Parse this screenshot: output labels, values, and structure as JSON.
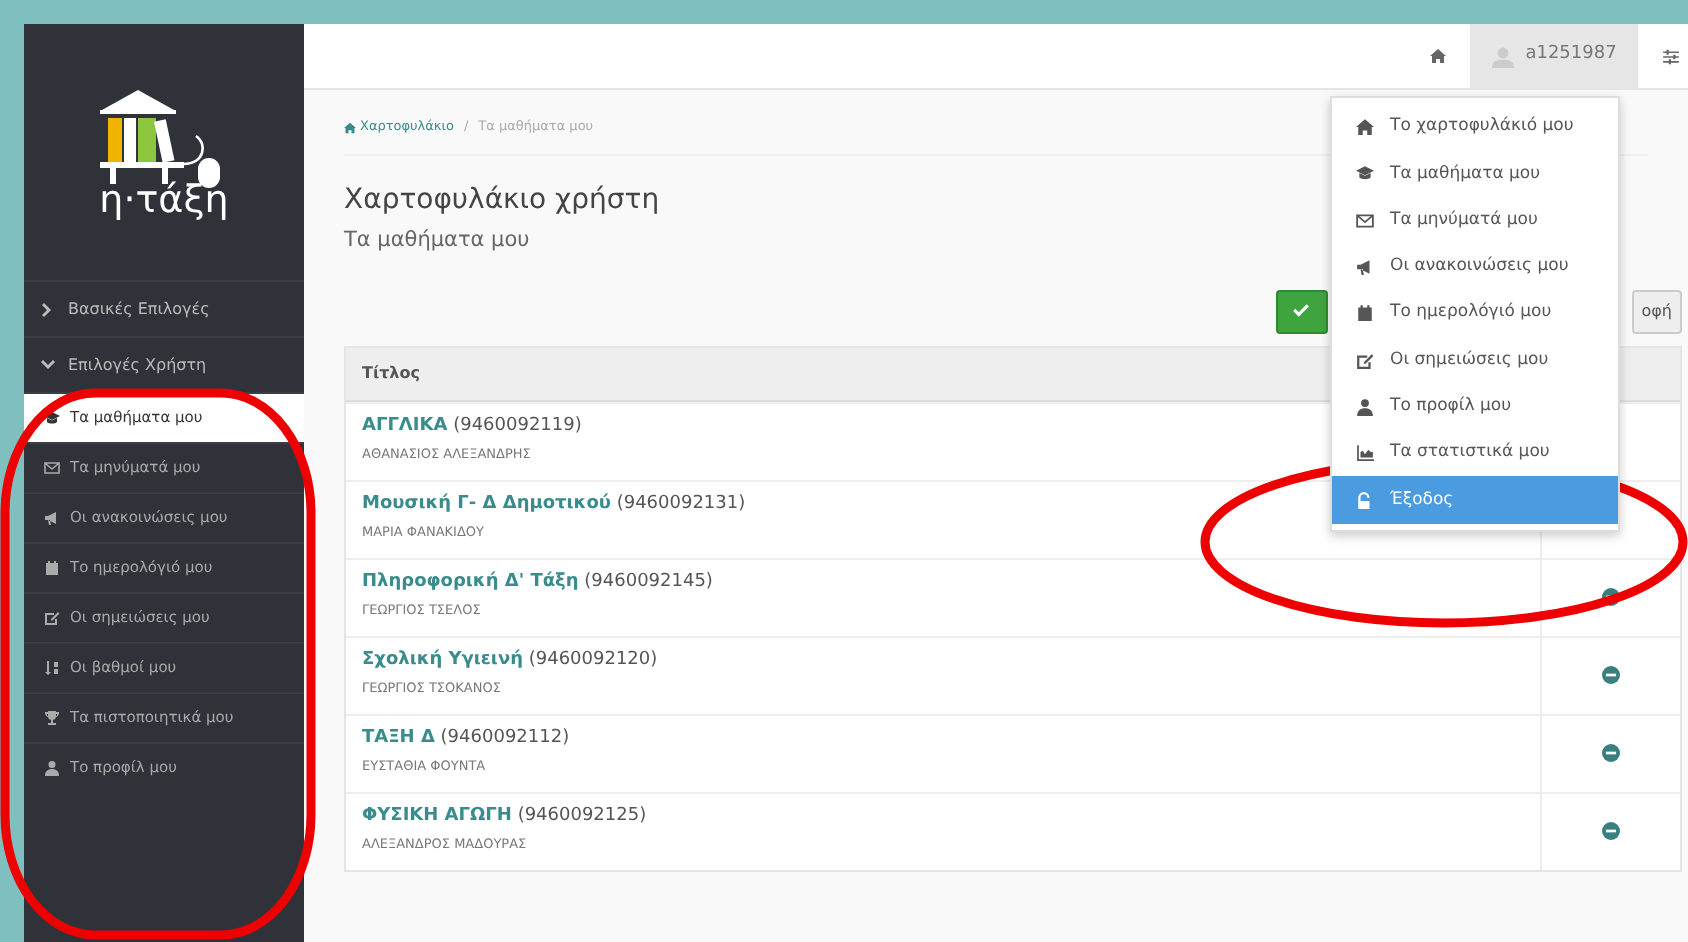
{
  "logo": {
    "text": "η·τάξη"
  },
  "top_nav": {
    "user": "a1251987",
    "user_menu_open": true
  },
  "user_menu": [
    {
      "label": "Το χαρτοφυλάκιό μου",
      "selected": false
    },
    {
      "label": "Τα μαθήματα μου",
      "selected": false
    },
    {
      "label": "Τα μηνύματά μου",
      "selected": false
    },
    {
      "label": "Οι ανακοινώσεις μου",
      "selected": false
    },
    {
      "label": "Το ημερολόγιό μου",
      "selected": false
    },
    {
      "label": "Οι σημειώσεις μου",
      "selected": false
    },
    {
      "label": "Το προφίλ μου",
      "selected": false
    },
    {
      "label": "Τα στατιστικά μου",
      "selected": false
    },
    {
      "label": "Έξοδος",
      "selected": true
    }
  ],
  "sidebar": {
    "sections": [
      {
        "label": "Βασικές Επιλογές",
        "expanded": false
      },
      {
        "label": "Επιλογές Χρήστη",
        "expanded": true,
        "children": [
          {
            "label": "Τα μαθήματα μου",
            "selected": true
          },
          {
            "label": "Τα μηνύματά μου",
            "selected": false
          },
          {
            "label": "Οι ανακοινώσεις μου",
            "selected": false
          },
          {
            "label": "Το ημερολόγιό μου",
            "selected": false
          },
          {
            "label": "Οι σημειώσεις μου",
            "selected": false
          },
          {
            "label": "Οι βαθμοί μου",
            "selected": false
          },
          {
            "label": "Τα πιστοποιητικά μου",
            "selected": false
          },
          {
            "label": "Το προφίλ μου",
            "selected": false
          }
        ]
      }
    ]
  },
  "breadcrumb": [
    "Χαρτοφυλάκιο",
    "Τα μαθήματα μου"
  ],
  "breadcrumb_separator": "/",
  "page_title": "Χαρτοφυλάκιο χρήστη",
  "page_subtitle": "Τα μαθήματα μου",
  "toolbar_buttons": [
    {
      "kind": "confirm"
    },
    {
      "kind": "text",
      "label": "οφή"
    }
  ],
  "table": {
    "columns": [
      "Τίτλος"
    ],
    "rows": [
      {
        "title": "ΑΓΓΛΙΚΑ",
        "code": "(9460092119)",
        "teacher": "ΑΘΑΝΑΣΙΟΣ ΑΛΕΞΑΝΔΡΗΣ"
      },
      {
        "title": "Μουσική Γ- Δ Δημοτικού",
        "code": "(9460092131)",
        "teacher": "ΜΑΡΙΑ ΦΑΝΑΚΙΔΟΥ"
      },
      {
        "title": "Πληροφορική Δ' Τάξη",
        "code": "(9460092145)",
        "teacher": "ΓΕΩΡΓΙΟΣ ΤΣΕΛΟΣ"
      },
      {
        "title": "Σχολική Υγιεινή",
        "code": "(9460092120)",
        "teacher": "ΓΕΩΡΓΙΟΣ ΤΣΟΚΑΝΟΣ"
      },
      {
        "title": "ΤΑΞΗ Δ",
        "code": "(9460092112)",
        "teacher": "ΕΥΣΤΑΘΙΑ ΦΟΥΝΤΑ"
      },
      {
        "title": "ΦΥΣΙΚΗ ΑΓΩΓΗ",
        "code": "(9460092125)",
        "teacher": "ΑΛΕΞΑΝΔΡΟΣ ΜΑΔΟΥΡΑΣ"
      }
    ]
  },
  "annotations": [
    {
      "kind": "ellipse"
    },
    {
      "kind": "ellipse"
    }
  ]
}
